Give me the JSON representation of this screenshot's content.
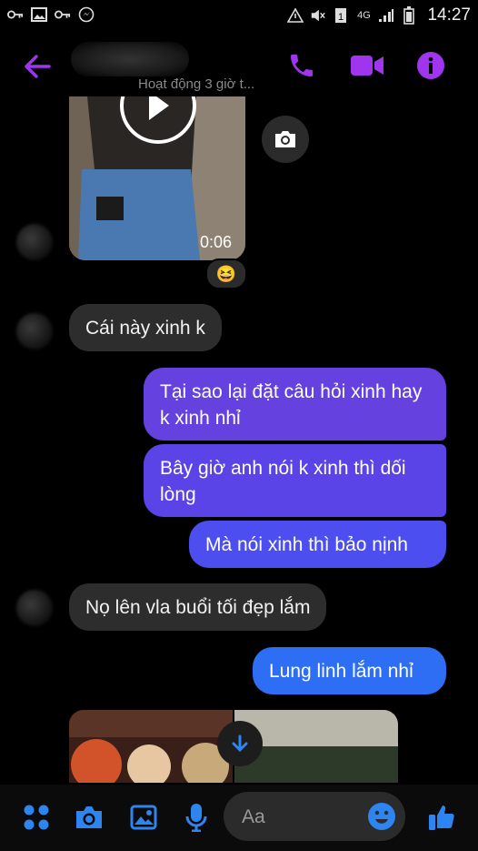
{
  "status_bar": {
    "time": "14:27",
    "network": "4G",
    "icons": [
      "key-icon",
      "image-icon",
      "key-icon",
      "messenger-icon",
      "warning-icon",
      "mute-icon",
      "sim-icon",
      "signal-icon",
      "battery-icon"
    ]
  },
  "header": {
    "subtitle": "Hoạt động 3 giờ t...",
    "accent_color": "#a035f0",
    "buttons": [
      "back-arrow-icon",
      "phone-icon",
      "video-icon",
      "info-icon"
    ]
  },
  "conversation": {
    "video": {
      "duration": "0:06",
      "reaction": "😆"
    },
    "messages": [
      {
        "from": "them",
        "text": "Cái này xinh k"
      },
      {
        "from": "me",
        "text": "Tại sao lại đặt câu hỏi xinh hay k xinh nhỉ"
      },
      {
        "from": "me",
        "text": "Bây giờ anh nói k xinh thì dối lòng"
      },
      {
        "from": "me",
        "text": "Mà nói xinh thì bảo nịnh"
      },
      {
        "from": "them",
        "text": "Nọ lên vla buổi tối đẹp lắm"
      },
      {
        "from": "me",
        "text": "Lung linh lắm nhỉ"
      }
    ]
  },
  "composer": {
    "placeholder": "Aa",
    "accent_color": "#2e84f0"
  }
}
